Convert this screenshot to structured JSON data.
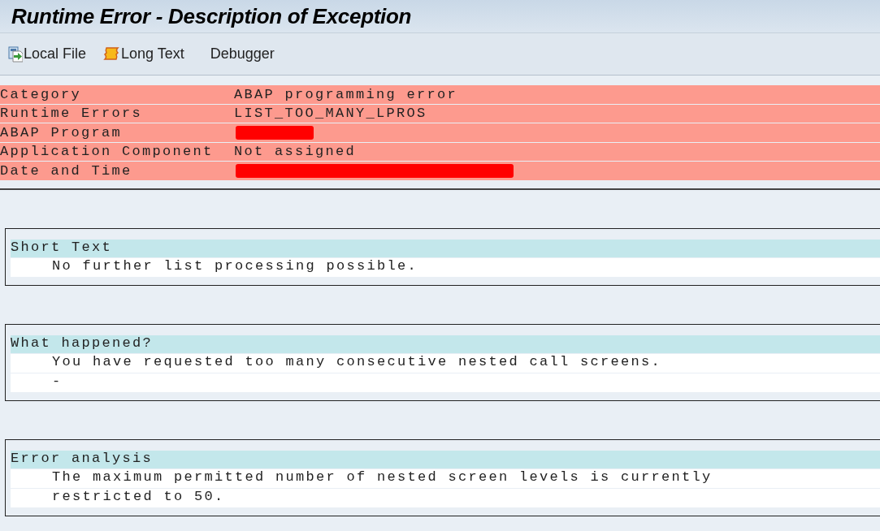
{
  "window": {
    "title": "Runtime Error - Description of Exception"
  },
  "toolbar": [
    {
      "label": "Local File",
      "kind": "export"
    },
    {
      "label": "Long Text",
      "kind": "scroll"
    },
    {
      "label": "Debugger",
      "kind": "plain"
    }
  ],
  "header_fields": [
    {
      "label": "Category",
      "value": "ABAP programming error",
      "kind": "text"
    },
    {
      "label": "Runtime Errors",
      "value": "LIST_TOO_MANY_LPROS",
      "kind": "text"
    },
    {
      "label": "ABAP Program",
      "kind": "redacted_short"
    },
    {
      "label": "Application Component",
      "value": "Not assigned",
      "kind": "text"
    },
    {
      "label": "Date and Time",
      "kind": "redacted_long"
    }
  ],
  "sections": [
    {
      "title": "Short Text",
      "lines": [
        "No further list processing possible."
      ]
    },
    {
      "title": "What happened?",
      "lines": [
        "You have requested too many consecutive nested call screens.",
        "-"
      ]
    },
    {
      "title": "Error analysis",
      "lines": [
        "The maximum permitted number of nested screen levels is currently",
        "restricted to 50."
      ]
    }
  ]
}
